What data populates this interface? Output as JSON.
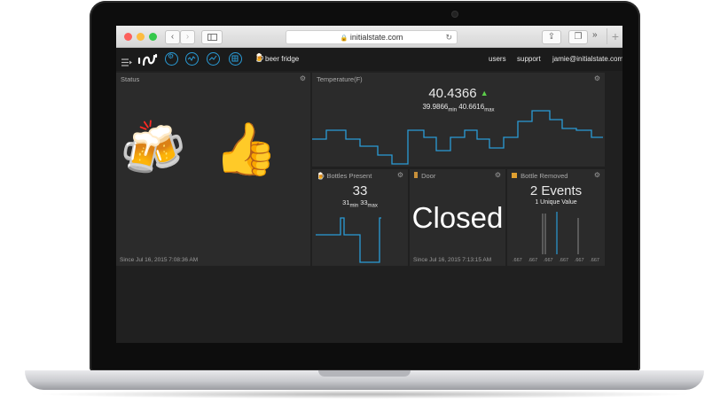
{
  "browser": {
    "url": "initialstate.com",
    "traffic_lights": [
      "#fc605c",
      "#fdbc40",
      "#34c84a"
    ]
  },
  "navbar": {
    "bucket_name": "beer fridge",
    "links": [
      "users",
      "support",
      "jamie@initialstate.com"
    ]
  },
  "tiles": {
    "status": {
      "title": "Status",
      "emoji_1": "🍻",
      "emoji_2": "👍",
      "since": "Since Jul 16, 2015 7:08:36 AM"
    },
    "temperature": {
      "title": "Temperature(F)",
      "value": "40.4366",
      "min_value": "39.9866",
      "min_label": "min",
      "max_value": "40.6616",
      "max_label": "max"
    },
    "bottles_present": {
      "title": "Bottles Present",
      "value": "33",
      "min_value": "31",
      "min_label": "min",
      "max_value": "33",
      "max_label": "max"
    },
    "door": {
      "title": "Door",
      "value": "Closed",
      "since": "Since Jul 16, 2015 7:13:15 AM"
    },
    "bottle_removed": {
      "title": "Bottle Removed",
      "value": "2 Events",
      "subtitle": "1 Unique Value",
      "tick_labels": [
        ".667",
        ".667",
        ".667",
        ".667",
        ".667",
        ".667"
      ]
    }
  },
  "colors": {
    "accent": "#2a9bd6",
    "up_arrow": "#5ccf4a",
    "tile_bg": "#2b2b2b"
  }
}
